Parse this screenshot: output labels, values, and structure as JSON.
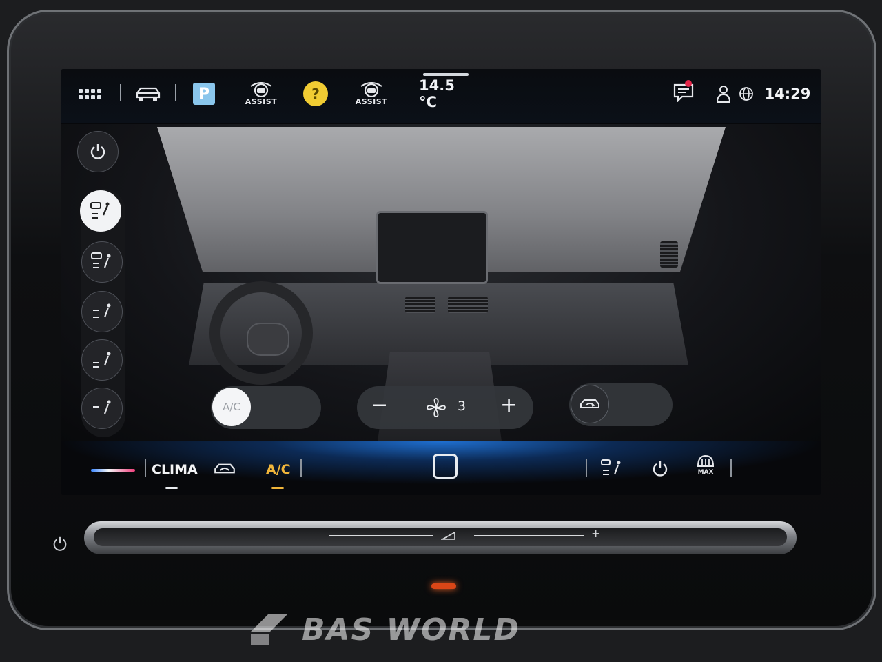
{
  "topbar": {
    "assist_label_1": "ASSIST",
    "assist_label_2": "ASSIST",
    "park_label": "P",
    "help_label": "?",
    "outside_temp": "14.5 °C",
    "clock": "14:29"
  },
  "controls": {
    "ac_label": "A/C",
    "fan_level": "3",
    "fan_minus": "−",
    "fan_plus": "+"
  },
  "bottombar": {
    "clima_label": "CLIMA",
    "ac_label": "A/C",
    "max_label": "MAX"
  },
  "watermark": {
    "text": "BAS WORLD"
  },
  "colors": {
    "accent_ac": "#f0b53a",
    "notification": "#e5274a",
    "park": "#8ac6ec",
    "help": "#f1cc33",
    "bottom_glow": "#1f6fd0",
    "led": "#d94617"
  }
}
